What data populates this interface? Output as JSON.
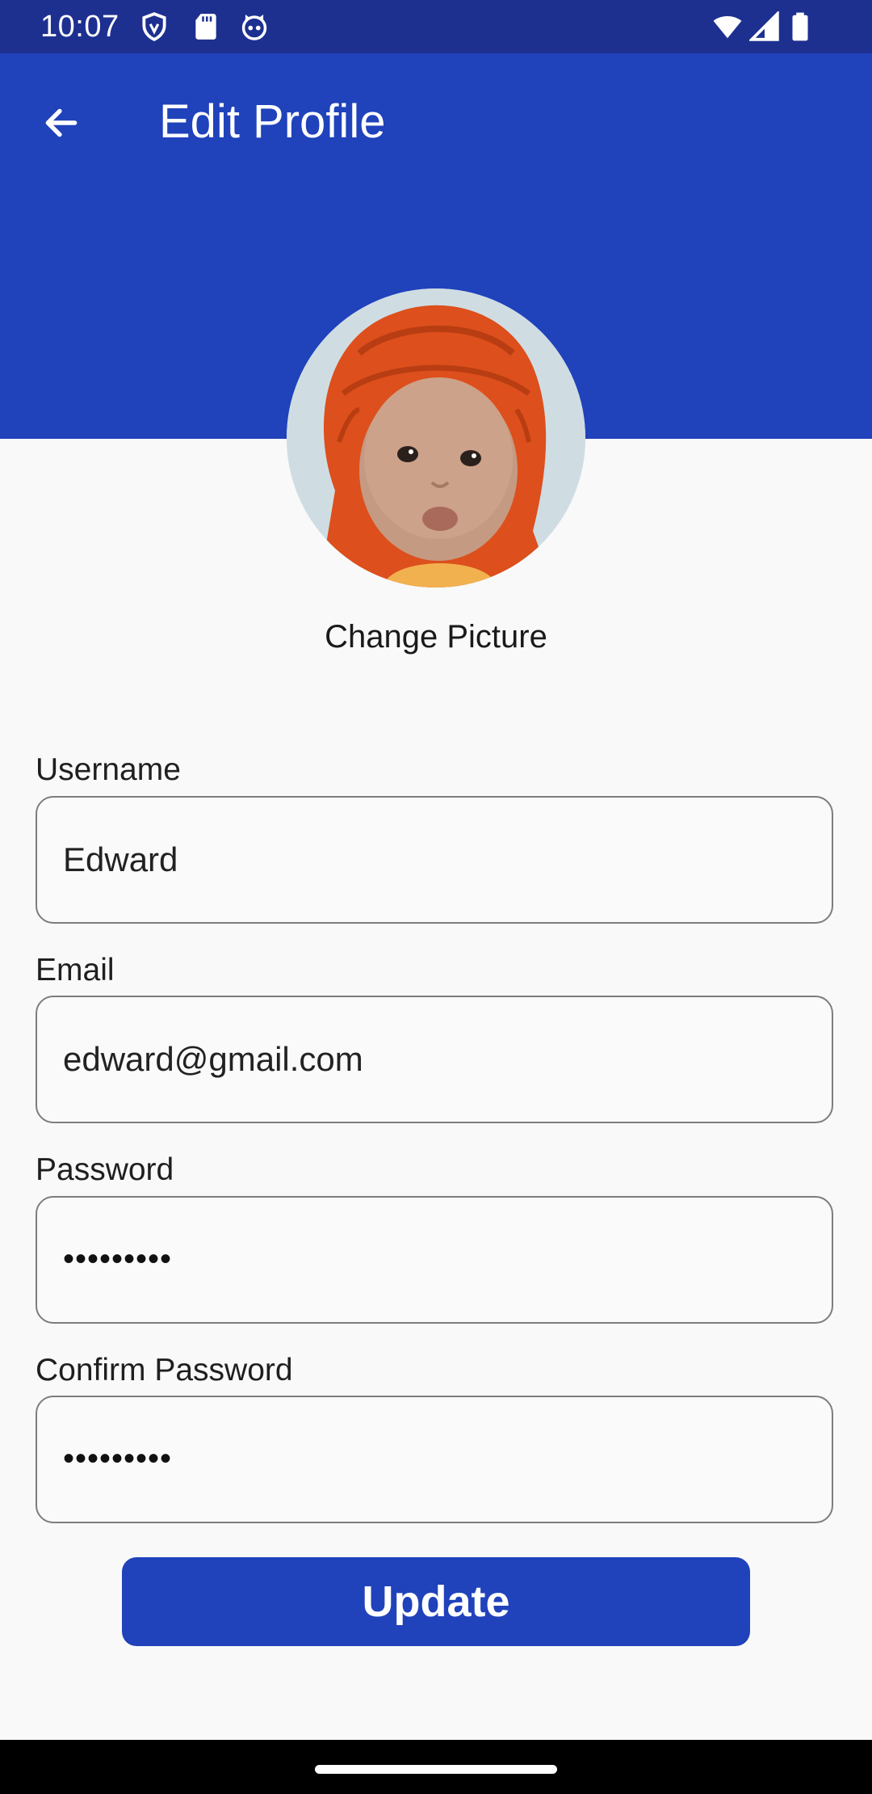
{
  "status_bar": {
    "time": "10:07",
    "left_icons": [
      "shield-icon",
      "sd-card-icon",
      "cat-face-icon"
    ],
    "right_icons": [
      "wifi-icon",
      "signal-icon",
      "battery-icon"
    ]
  },
  "header": {
    "title": "Edit Profile",
    "back_icon": "arrow-left-icon"
  },
  "profile": {
    "change_picture_label": "Change Picture"
  },
  "form": {
    "fields": [
      {
        "label": "Username",
        "value": "Edward"
      },
      {
        "label": "Email",
        "value": "edward@gmail.com"
      },
      {
        "label": "Password",
        "value": "•••••••••"
      },
      {
        "label": "Confirm Password",
        "value": "•••••••••"
      }
    ],
    "submit_label": "Update"
  },
  "colors": {
    "status_bar": "#1d3090",
    "header": "#2042bb",
    "button": "#2042bb",
    "background": "#f9f9f9"
  }
}
